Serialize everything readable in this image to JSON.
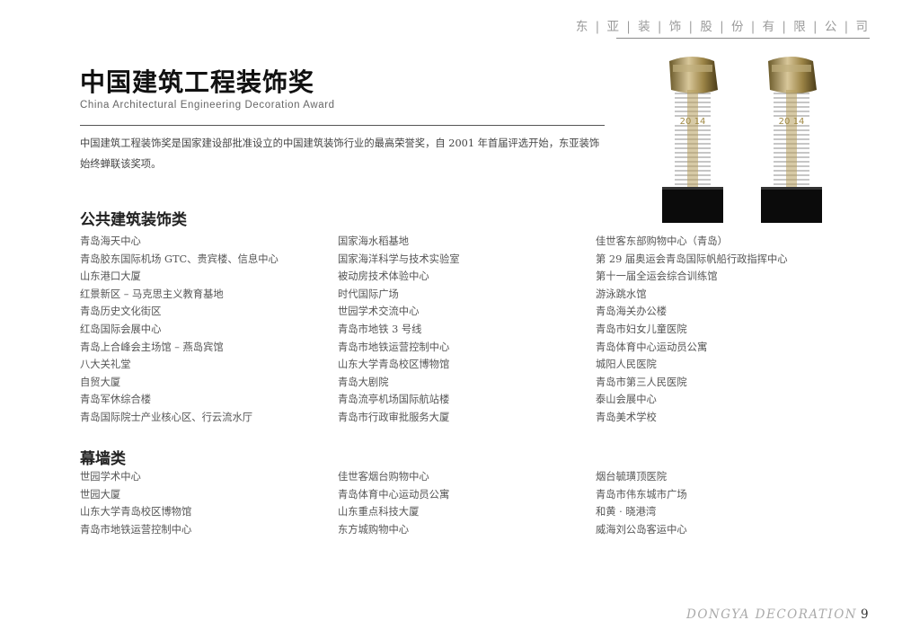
{
  "header": {
    "company": "东 | 亚 | 装 | 饰 | 股 | 份 | 有 | 限 | 公 | 司"
  },
  "title": "中国建筑工程装饰奖",
  "subtitle": "China Architectural Engineering Decoration Award",
  "intro": "中国建筑工程装饰奖是国家建设部批准设立的中国建筑装饰行业的最高荣誉奖，自 2001 年首届评选开始，东亚装饰始终蝉联该奖项。",
  "trophies": [
    {
      "engraving": "20 14"
    },
    {
      "engraving": "20 14"
    }
  ],
  "sections": [
    {
      "title": "公共建筑装饰类",
      "columns": [
        [
          "青岛海天中心",
          "青岛胶东国际机场 GTC、贵宾楼、信息中心",
          "山东港口大厦",
          "红景新区 – 马克思主义教育基地",
          "青岛历史文化街区",
          "红岛国际会展中心",
          "青岛上合峰会主场馆 – 燕岛宾馆",
          "八大关礼堂",
          "自贸大厦",
          "青岛军休综合楼",
          "青岛国际院士产业核心区、行云流水厅"
        ],
        [
          "国家海水稻基地",
          "国家海洋科学与技术实验室",
          "被动房技术体验中心",
          "时代国际广场",
          "世园学术交流中心",
          "青岛市地铁 3 号线",
          "青岛市地铁运营控制中心",
          "山东大学青岛校区博物馆",
          "青岛大剧院",
          "青岛流亭机场国际航站楼",
          "青岛市行政审批服务大厦"
        ],
        [
          "佳世客东部购物中心（青岛）",
          "第 29 届奥运会青岛国际帆船行政指挥中心",
          "第十一届全运会综合训练馆",
          "游泳跳水馆",
          "青岛海关办公楼",
          "青岛市妇女儿童医院",
          "青岛体育中心运动员公寓",
          "城阳人民医院",
          "青岛市第三人民医院",
          "泰山会展中心",
          "青岛美术学校"
        ]
      ]
    },
    {
      "title": "幕墙类",
      "columns": [
        [
          "世园学术中心",
          "世园大厦",
          "山东大学青岛校区博物馆",
          "青岛市地铁运营控制中心"
        ],
        [
          "佳世客烟台购物中心",
          "青岛体育中心运动员公寓",
          "山东重点科技大厦",
          "东方城购物中心"
        ],
        [
          "烟台毓璜顶医院",
          "青岛市伟东城市广场",
          "和黄 · 晓港湾",
          "威海刘公岛客运中心"
        ]
      ]
    }
  ],
  "footer": {
    "brand": "DONGYA  DECORATION",
    "page": "9"
  }
}
